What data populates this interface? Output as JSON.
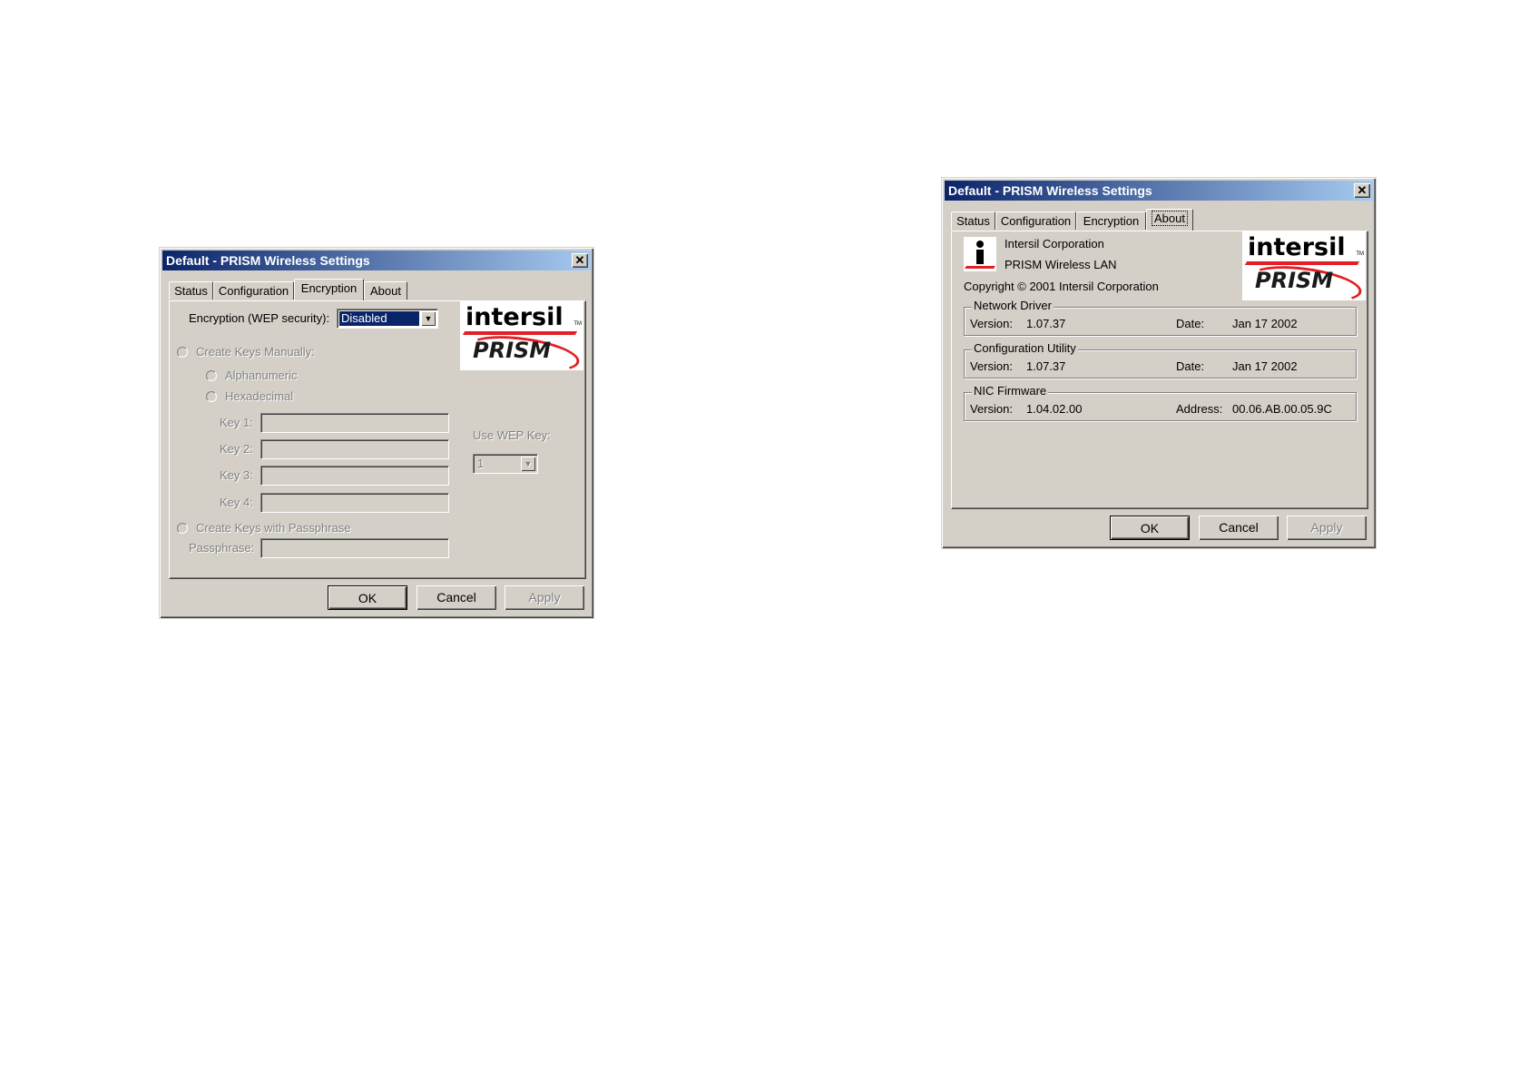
{
  "left_dialog": {
    "title": "Default - PRISM Wireless Settings",
    "close_glyph": "✕",
    "tabs": [
      "Status",
      "Configuration",
      "Encryption",
      "About"
    ],
    "active_tab": "Encryption",
    "encryption_label": "Encryption (WEP security):",
    "encryption_value": "Disabled",
    "create_keys_manually": "Create Keys Manually:",
    "alphanumeric": "Alphanumeric",
    "hexadecimal": "Hexadecimal",
    "keys": [
      "Key 1:",
      "Key 2:",
      "Key 3:",
      "Key 4:"
    ],
    "use_wep_key_label": "Use WEP Key:",
    "use_wep_key_value": "1",
    "create_keys_passphrase": "Create Keys with Passphrase",
    "passphrase_label": "Passphrase:",
    "buttons": {
      "ok": "OK",
      "cancel": "Cancel",
      "apply": "Apply"
    },
    "logo": {
      "brand": "intersil",
      "tm": "TM",
      "product": "PRISM"
    }
  },
  "right_dialog": {
    "title": "Default - PRISM Wireless Settings",
    "close_glyph": "✕",
    "tabs": [
      "Status",
      "Configuration",
      "Encryption",
      "About"
    ],
    "active_tab": "About",
    "company": "Intersil Corporation",
    "product": "PRISM Wireless LAN",
    "copyright": "Copyright © 2001  Intersil Corporation",
    "groups": [
      {
        "title": "Network Driver",
        "k1": "Version:",
        "v1": "1.07.37",
        "k2": "Date:",
        "v2": "Jan 17 2002"
      },
      {
        "title": "Configuration Utility",
        "k1": "Version:",
        "v1": "1.07.37",
        "k2": "Date:",
        "v2": "Jan 17 2002"
      },
      {
        "title": "NIC Firmware",
        "k1": "Version:",
        "v1": "1.04.02.00",
        "k2": "Address:",
        "v2": "00.06.AB.00.05.9C"
      }
    ],
    "buttons": {
      "ok": "OK",
      "cancel": "Cancel",
      "apply": "Apply"
    },
    "logo": {
      "brand": "intersil",
      "tm": "TM",
      "product": "PRISM"
    }
  },
  "colors": {
    "titlebar_start": "#0a246a",
    "titlebar_end": "#a6caf0",
    "face": "#d4d0c8",
    "logo_red": "#e31e24"
  }
}
